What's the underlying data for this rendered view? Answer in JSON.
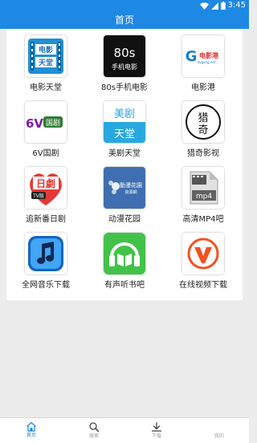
{
  "status": {
    "time": "3:45"
  },
  "appbar": {
    "title": "首页"
  },
  "apps": [
    {
      "label": "电影天堂",
      "icon": "movie-heaven-icon",
      "logo_lines": [
        "电影",
        "天堂"
      ]
    },
    {
      "label": "80s手机电影",
      "icon": "80s-movie-icon",
      "logo_lines": [
        "80s",
        "手机电影"
      ]
    },
    {
      "label": "电影港",
      "icon": "movie-port-icon",
      "logo_lines": [
        "电影港",
        "dygang.net"
      ]
    },
    {
      "label": "6V国剧",
      "icon": "6v-drama-icon",
      "logo_lines": [
        "6V",
        "国剧"
      ]
    },
    {
      "label": "美剧天堂",
      "icon": "us-drama-heaven-icon",
      "logo_lines": [
        "美剧",
        "天堂"
      ]
    },
    {
      "label": "猎奇影视",
      "icon": "lieqi-video-icon",
      "logo_lines": [
        "猎",
        "奇"
      ]
    },
    {
      "label": "追新番日剧",
      "icon": "jp-drama-icon",
      "logo_lines": [
        "日劇",
        "TV版"
      ]
    },
    {
      "label": "动漫花园",
      "icon": "anime-garden-icon",
      "logo_lines": [
        "動漫花園",
        "資源網"
      ]
    },
    {
      "label": "高清MP4吧",
      "icon": "hd-mp4-icon",
      "logo_lines": [
        "mp4"
      ]
    },
    {
      "label": "全网音乐下载",
      "icon": "music-download-icon",
      "logo_lines": []
    },
    {
      "label": "有声听书吧",
      "icon": "audiobook-icon",
      "logo_lines": []
    },
    {
      "label": "在线视频下载",
      "icon": "video-download-icon",
      "logo_lines": []
    }
  ],
  "nav": [
    {
      "label": "首页",
      "icon": "home-icon",
      "active": true
    },
    {
      "label": "搜索",
      "icon": "search-icon",
      "active": false
    },
    {
      "label": "下载",
      "icon": "download-icon",
      "active": false
    },
    {
      "label": "我的",
      "icon": "profile-icon",
      "active": false
    }
  ],
  "colors": {
    "accent": "#1e88e5",
    "background": "#ececec",
    "card": "#ffffff"
  }
}
